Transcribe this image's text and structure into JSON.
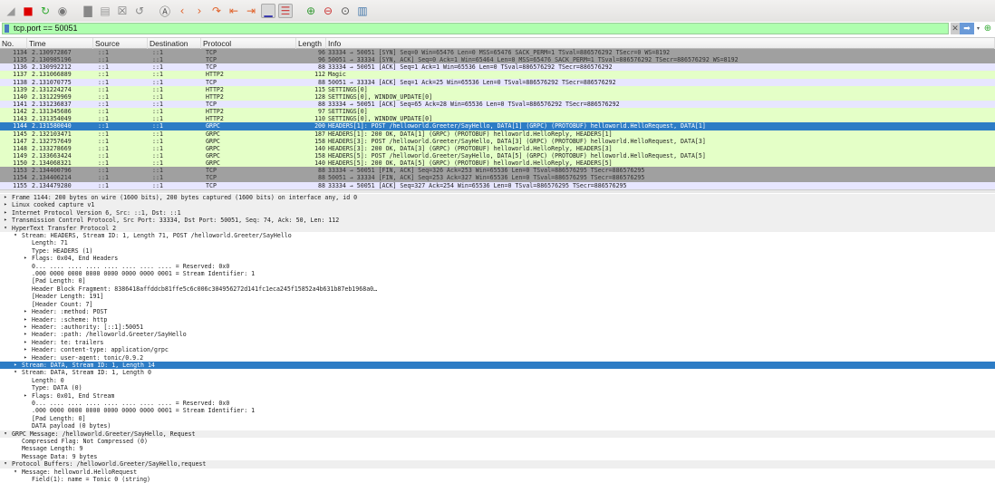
{
  "toolbar": {
    "icons": [
      "shark-fin-start-icon",
      "stop-capture-icon",
      "restart-capture-icon",
      "capture-options-icon",
      "open-file-icon",
      "save-file-icon",
      "close-file-icon",
      "reload-icon",
      "find-packet-icon",
      "go-back-icon",
      "go-forward-icon",
      "go-to-packet-icon",
      "first-packet-icon",
      "last-packet-icon",
      "autoscroll-icon",
      "colorize-icon",
      "zoom-in-icon",
      "zoom-out-icon",
      "normal-size-icon",
      "resize-columns-icon"
    ]
  },
  "filter": {
    "value": "tcp.port == 50051"
  },
  "columns": [
    "No.",
    "Time",
    "Source",
    "Destination",
    "Protocol",
    "Length",
    "Info"
  ],
  "packets": [
    {
      "no": "1134",
      "time": "2.130972867",
      "src": "::1",
      "dst": "::1",
      "proto": "TCP",
      "len": "96",
      "info": "33334 → 50051 [SYN] Seq=0 Win=65476 Len=0 MSS=65476 SACK_PERM=1 TSval=886576292 TSecr=0 WS=8192",
      "style": "bad"
    },
    {
      "no": "1135",
      "time": "2.130985196",
      "src": "::1",
      "dst": "::1",
      "proto": "TCP",
      "len": "96",
      "info": "50051 → 33334 [SYN, ACK] Seq=0 Ack=1 Win=65464 Len=0 MSS=65476 SACK_PERM=1 TSval=886576292 TSecr=886576292 WS=8192",
      "style": "bad"
    },
    {
      "no": "1136",
      "time": "2.130992212",
      "src": "::1",
      "dst": "::1",
      "proto": "TCP",
      "len": "88",
      "info": "33334 → 50051 [ACK] Seq=1 Ack=1 Win=65536 Len=0 TSval=886576292 TSecr=886576292",
      "style": "tcp"
    },
    {
      "no": "1137",
      "time": "2.131066889",
      "src": "::1",
      "dst": "::1",
      "proto": "HTTP2",
      "len": "112",
      "info": "Magic",
      "style": "h2"
    },
    {
      "no": "1138",
      "time": "2.131070775",
      "src": "::1",
      "dst": "::1",
      "proto": "TCP",
      "len": "88",
      "info": "50051 → 33334 [ACK] Seq=1 Ack=25 Win=65536 Len=0 TSval=886576292 TSecr=886576292",
      "style": "tcp"
    },
    {
      "no": "1139",
      "time": "2.131224274",
      "src": "::1",
      "dst": "::1",
      "proto": "HTTP2",
      "len": "115",
      "info": "SETTINGS[0]",
      "style": "h2"
    },
    {
      "no": "1140",
      "time": "2.131229969",
      "src": "::1",
      "dst": "::1",
      "proto": "HTTP2",
      "len": "128",
      "info": "SETTINGS[0], WINDOW_UPDATE[0]",
      "style": "h2"
    },
    {
      "no": "1141",
      "time": "2.131236837",
      "src": "::1",
      "dst": "::1",
      "proto": "TCP",
      "len": "88",
      "info": "33334 → 50051 [ACK] Seq=65 Ack=28 Win=65536 Len=0 TSval=886576292 TSecr=886576292",
      "style": "tcp"
    },
    {
      "no": "1142",
      "time": "2.131345686",
      "src": "::1",
      "dst": "::1",
      "proto": "HTTP2",
      "len": "97",
      "info": "SETTINGS[0]",
      "style": "h2"
    },
    {
      "no": "1143",
      "time": "2.131354049",
      "src": "::1",
      "dst": "::1",
      "proto": "HTTP2",
      "len": "110",
      "info": "SETTINGS[0], WINDOW_UPDATE[0]",
      "style": "h2"
    },
    {
      "no": "1144",
      "time": "2.131580040",
      "src": "::1",
      "dst": "::1",
      "proto": "GRPC",
      "len": "200",
      "info": "HEADERS[1]: POST /helloworld.Greeter/SayHello, DATA[1] (GRPC) (PROTOBUF) helloworld.HelloRequest, DATA[1]",
      "style": "sel"
    },
    {
      "no": "1145",
      "time": "2.132103471",
      "src": "::1",
      "dst": "::1",
      "proto": "GRPC",
      "len": "187",
      "info": "HEADERS[1]: 200 OK, DATA[1] (GRPC) (PROTOBUF) helloworld.HelloReply, HEADERS[1]",
      "style": "h2"
    },
    {
      "no": "1147",
      "time": "2.132757649",
      "src": "::1",
      "dst": "::1",
      "proto": "GRPC",
      "len": "158",
      "info": "HEADERS[3]: POST /helloworld.Greeter/SayHello, DATA[3] (GRPC) (PROTOBUF) helloworld.HelloRequest, DATA[3]",
      "style": "h2"
    },
    {
      "no": "1148",
      "time": "2.133278669",
      "src": "::1",
      "dst": "::1",
      "proto": "GRPC",
      "len": "140",
      "info": "HEADERS[3]: 200 OK, DATA[3] (GRPC) (PROTOBUF) helloworld.HelloReply, HEADERS[3]",
      "style": "h2"
    },
    {
      "no": "1149",
      "time": "2.133663424",
      "src": "::1",
      "dst": "::1",
      "proto": "GRPC",
      "len": "158",
      "info": "HEADERS[5]: POST /helloworld.Greeter/SayHello, DATA[5] (GRPC) (PROTOBUF) helloworld.HelloRequest, DATA[5]",
      "style": "h2"
    },
    {
      "no": "1150",
      "time": "2.134068321",
      "src": "::1",
      "dst": "::1",
      "proto": "GRPC",
      "len": "140",
      "info": "HEADERS[5]: 200 OK, DATA[5] (GRPC) (PROTOBUF) helloworld.HelloReply, HEADERS[5]",
      "style": "h2"
    },
    {
      "no": "1153",
      "time": "2.134400796",
      "src": "::1",
      "dst": "::1",
      "proto": "TCP",
      "len": "88",
      "info": "33334 → 50051 [FIN, ACK] Seq=326 Ack=253 Win=65536 Len=0 TSval=886576295 TSecr=886576295",
      "style": "bad"
    },
    {
      "no": "1154",
      "time": "2.134406214",
      "src": "::1",
      "dst": "::1",
      "proto": "TCP",
      "len": "88",
      "info": "50051 → 33334 [FIN, ACK] Seq=253 Ack=327 Win=65536 Len=0 TSval=886576295 TSecr=886576295",
      "style": "bad"
    },
    {
      "no": "1155",
      "time": "2.134479280",
      "src": "::1",
      "dst": "::1",
      "proto": "TCP",
      "len": "88",
      "info": "33334 → 50051 [ACK] Seq=327 Ack=254 Win=65536 Len=0 TSval=886576295 TSecr=886576295",
      "style": "tcp"
    }
  ],
  "details": [
    {
      "text": "Frame 1144: 200 bytes on wire (1600 bits), 200 bytes captured (1600 bits) on interface any, id 0",
      "level": 0,
      "state": "collapsed"
    },
    {
      "text": "Linux cooked capture v1",
      "level": 0,
      "state": "collapsed"
    },
    {
      "text": "Internet Protocol Version 6, Src: ::1, Dst: ::1",
      "level": 0,
      "state": "collapsed"
    },
    {
      "text": "Transmission Control Protocol, Src Port: 33334, Dst Port: 50051, Seq: 74, Ack: 50, Len: 112",
      "level": 0,
      "state": "collapsed"
    },
    {
      "text": "HyperText Transfer Protocol 2",
      "level": 0,
      "state": "expanded"
    },
    {
      "text": "Stream: HEADERS, Stream ID: 1, Length 71, POST /helloworld.Greeter/SayHello",
      "level": 1,
      "state": "expanded"
    },
    {
      "text": "Length: 71",
      "level": 2,
      "state": "leaf"
    },
    {
      "text": "Type: HEADERS (1)",
      "level": 2,
      "state": "leaf"
    },
    {
      "text": "Flags: 0x04, End Headers",
      "level": 2,
      "state": "collapsed"
    },
    {
      "text": "0... .... .... .... .... .... .... .... = Reserved: 0x0",
      "level": 2,
      "state": "leaf"
    },
    {
      "text": ".000 0000 0000 0000 0000 0000 0000 0001 = Stream Identifier: 1",
      "level": 2,
      "state": "leaf"
    },
    {
      "text": "[Pad Length: 0]",
      "level": 2,
      "state": "leaf"
    },
    {
      "text": "Header Block Fragment: 8386418affddcb81ffe5c6c006c304956272d141fc1eca245f15852a4b631b87eb1968a0…",
      "level": 2,
      "state": "leaf"
    },
    {
      "text": "[Header Length: 191]",
      "level": 2,
      "state": "leaf"
    },
    {
      "text": "[Header Count: 7]",
      "level": 2,
      "state": "leaf"
    },
    {
      "text": "Header: :method: POST",
      "level": 2,
      "state": "collapsed"
    },
    {
      "text": "Header: :scheme: http",
      "level": 2,
      "state": "collapsed"
    },
    {
      "text": "Header: :authority: [::1]:50051",
      "level": 2,
      "state": "collapsed"
    },
    {
      "text": "Header: :path: /helloworld.Greeter/SayHello",
      "level": 2,
      "state": "collapsed"
    },
    {
      "text": "Header: te: trailers",
      "level": 2,
      "state": "collapsed"
    },
    {
      "text": "Header: content-type: application/grpc",
      "level": 2,
      "state": "collapsed"
    },
    {
      "text": "Header: user-agent: tonic/0.9.2",
      "level": 2,
      "state": "collapsed"
    },
    {
      "text": "Stream: DATA, Stream ID: 1, Length 14",
      "level": 1,
      "state": "collapsed",
      "selected": true
    },
    {
      "text": "Stream: DATA, Stream ID: 1, Length 0",
      "level": 1,
      "state": "expanded"
    },
    {
      "text": "Length: 0",
      "level": 2,
      "state": "leaf"
    },
    {
      "text": "Type: DATA (0)",
      "level": 2,
      "state": "leaf"
    },
    {
      "text": "Flags: 0x01, End Stream",
      "level": 2,
      "state": "collapsed"
    },
    {
      "text": "0... .... .... .... .... .... .... .... = Reserved: 0x0",
      "level": 2,
      "state": "leaf"
    },
    {
      "text": ".000 0000 0000 0000 0000 0000 0000 0001 = Stream Identifier: 1",
      "level": 2,
      "state": "leaf"
    },
    {
      "text": "[Pad Length: 0]",
      "level": 2,
      "state": "leaf"
    },
    {
      "text": "DATA payload (0 bytes)",
      "level": 2,
      "state": "leaf"
    },
    {
      "text": "GRPC Message: /helloworld.Greeter/SayHello, Request",
      "level": 0,
      "state": "expanded"
    },
    {
      "text": "Compressed Flag: Not Compressed (0)",
      "level": 1,
      "state": "leaf"
    },
    {
      "text": "Message Length: 9",
      "level": 1,
      "state": "leaf"
    },
    {
      "text": "Message Data: 9 bytes",
      "level": 1,
      "state": "leaf"
    },
    {
      "text": "Protocol Buffers: /helloworld.Greeter/SayHello,request",
      "level": 0,
      "state": "expanded"
    },
    {
      "text": "Message: helloworld.HelloRequest",
      "level": 1,
      "state": "expanded"
    },
    {
      "text": "Field(1): name = Tonic 0 (string)",
      "level": 2,
      "state": "leaf"
    }
  ]
}
